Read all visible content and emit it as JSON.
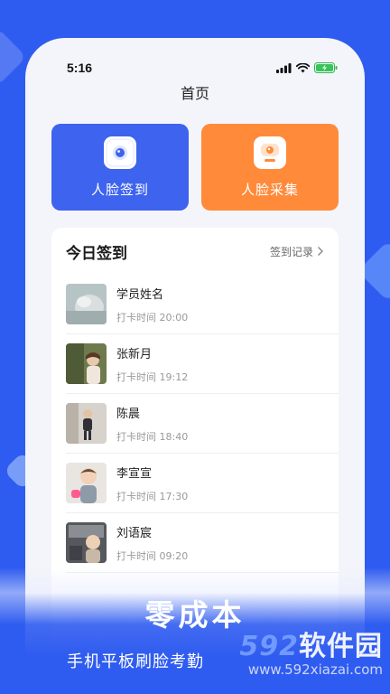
{
  "status_bar": {
    "time": "5:16"
  },
  "header": {
    "title": "首页"
  },
  "actions": [
    {
      "label": "人脸签到",
      "color": "#3e63ee",
      "icon": "camera-icon"
    },
    {
      "label": "人脸采集",
      "color": "#ff8a3a",
      "icon": "face-capture-icon"
    }
  ],
  "checkin_list": {
    "title": "今日签到",
    "history_link": "签到记录",
    "rows": [
      {
        "name": "学员姓名",
        "time": "打卡时间 20:00"
      },
      {
        "name": "张新月",
        "time": "打卡时间 19:12"
      },
      {
        "name": "陈晨",
        "time": "打卡时间 18:40"
      },
      {
        "name": "李宣宣",
        "time": "打卡时间 17:30"
      },
      {
        "name": "刘语宸",
        "time": "打卡时间 09:20"
      }
    ]
  },
  "promo": {
    "slogan": "零成本",
    "subtitle": "手机平板刷脸考勤"
  },
  "watermark": {
    "logo_number": "592",
    "logo_text": "软件园",
    "url": "www.592xiazai.com"
  },
  "colors": {
    "background": "#2f5cf0",
    "primary": "#3e63ee",
    "accent": "#ff8a3a"
  }
}
